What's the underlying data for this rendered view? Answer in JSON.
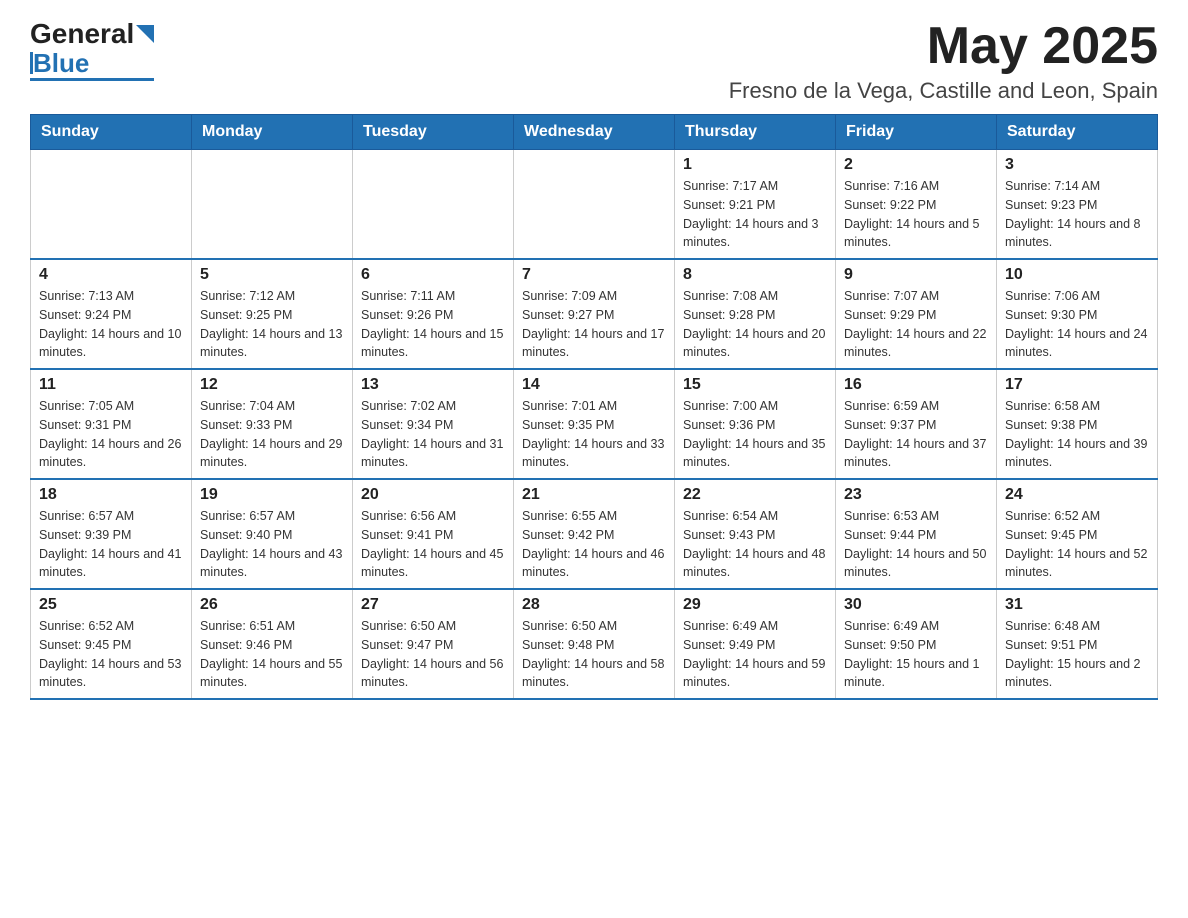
{
  "header": {
    "logo_general": "General",
    "logo_blue": "Blue",
    "month_title": "May 2025",
    "location": "Fresno de la Vega, Castille and Leon, Spain"
  },
  "days_of_week": [
    "Sunday",
    "Monday",
    "Tuesday",
    "Wednesday",
    "Thursday",
    "Friday",
    "Saturday"
  ],
  "weeks": [
    [
      {
        "day": "",
        "info": ""
      },
      {
        "day": "",
        "info": ""
      },
      {
        "day": "",
        "info": ""
      },
      {
        "day": "",
        "info": ""
      },
      {
        "day": "1",
        "info": "Sunrise: 7:17 AM\nSunset: 9:21 PM\nDaylight: 14 hours and 3 minutes."
      },
      {
        "day": "2",
        "info": "Sunrise: 7:16 AM\nSunset: 9:22 PM\nDaylight: 14 hours and 5 minutes."
      },
      {
        "day": "3",
        "info": "Sunrise: 7:14 AM\nSunset: 9:23 PM\nDaylight: 14 hours and 8 minutes."
      }
    ],
    [
      {
        "day": "4",
        "info": "Sunrise: 7:13 AM\nSunset: 9:24 PM\nDaylight: 14 hours and 10 minutes."
      },
      {
        "day": "5",
        "info": "Sunrise: 7:12 AM\nSunset: 9:25 PM\nDaylight: 14 hours and 13 minutes."
      },
      {
        "day": "6",
        "info": "Sunrise: 7:11 AM\nSunset: 9:26 PM\nDaylight: 14 hours and 15 minutes."
      },
      {
        "day": "7",
        "info": "Sunrise: 7:09 AM\nSunset: 9:27 PM\nDaylight: 14 hours and 17 minutes."
      },
      {
        "day": "8",
        "info": "Sunrise: 7:08 AM\nSunset: 9:28 PM\nDaylight: 14 hours and 20 minutes."
      },
      {
        "day": "9",
        "info": "Sunrise: 7:07 AM\nSunset: 9:29 PM\nDaylight: 14 hours and 22 minutes."
      },
      {
        "day": "10",
        "info": "Sunrise: 7:06 AM\nSunset: 9:30 PM\nDaylight: 14 hours and 24 minutes."
      }
    ],
    [
      {
        "day": "11",
        "info": "Sunrise: 7:05 AM\nSunset: 9:31 PM\nDaylight: 14 hours and 26 minutes."
      },
      {
        "day": "12",
        "info": "Sunrise: 7:04 AM\nSunset: 9:33 PM\nDaylight: 14 hours and 29 minutes."
      },
      {
        "day": "13",
        "info": "Sunrise: 7:02 AM\nSunset: 9:34 PM\nDaylight: 14 hours and 31 minutes."
      },
      {
        "day": "14",
        "info": "Sunrise: 7:01 AM\nSunset: 9:35 PM\nDaylight: 14 hours and 33 minutes."
      },
      {
        "day": "15",
        "info": "Sunrise: 7:00 AM\nSunset: 9:36 PM\nDaylight: 14 hours and 35 minutes."
      },
      {
        "day": "16",
        "info": "Sunrise: 6:59 AM\nSunset: 9:37 PM\nDaylight: 14 hours and 37 minutes."
      },
      {
        "day": "17",
        "info": "Sunrise: 6:58 AM\nSunset: 9:38 PM\nDaylight: 14 hours and 39 minutes."
      }
    ],
    [
      {
        "day": "18",
        "info": "Sunrise: 6:57 AM\nSunset: 9:39 PM\nDaylight: 14 hours and 41 minutes."
      },
      {
        "day": "19",
        "info": "Sunrise: 6:57 AM\nSunset: 9:40 PM\nDaylight: 14 hours and 43 minutes."
      },
      {
        "day": "20",
        "info": "Sunrise: 6:56 AM\nSunset: 9:41 PM\nDaylight: 14 hours and 45 minutes."
      },
      {
        "day": "21",
        "info": "Sunrise: 6:55 AM\nSunset: 9:42 PM\nDaylight: 14 hours and 46 minutes."
      },
      {
        "day": "22",
        "info": "Sunrise: 6:54 AM\nSunset: 9:43 PM\nDaylight: 14 hours and 48 minutes."
      },
      {
        "day": "23",
        "info": "Sunrise: 6:53 AM\nSunset: 9:44 PM\nDaylight: 14 hours and 50 minutes."
      },
      {
        "day": "24",
        "info": "Sunrise: 6:52 AM\nSunset: 9:45 PM\nDaylight: 14 hours and 52 minutes."
      }
    ],
    [
      {
        "day": "25",
        "info": "Sunrise: 6:52 AM\nSunset: 9:45 PM\nDaylight: 14 hours and 53 minutes."
      },
      {
        "day": "26",
        "info": "Sunrise: 6:51 AM\nSunset: 9:46 PM\nDaylight: 14 hours and 55 minutes."
      },
      {
        "day": "27",
        "info": "Sunrise: 6:50 AM\nSunset: 9:47 PM\nDaylight: 14 hours and 56 minutes."
      },
      {
        "day": "28",
        "info": "Sunrise: 6:50 AM\nSunset: 9:48 PM\nDaylight: 14 hours and 58 minutes."
      },
      {
        "day": "29",
        "info": "Sunrise: 6:49 AM\nSunset: 9:49 PM\nDaylight: 14 hours and 59 minutes."
      },
      {
        "day": "30",
        "info": "Sunrise: 6:49 AM\nSunset: 9:50 PM\nDaylight: 15 hours and 1 minute."
      },
      {
        "day": "31",
        "info": "Sunrise: 6:48 AM\nSunset: 9:51 PM\nDaylight: 15 hours and 2 minutes."
      }
    ]
  ]
}
